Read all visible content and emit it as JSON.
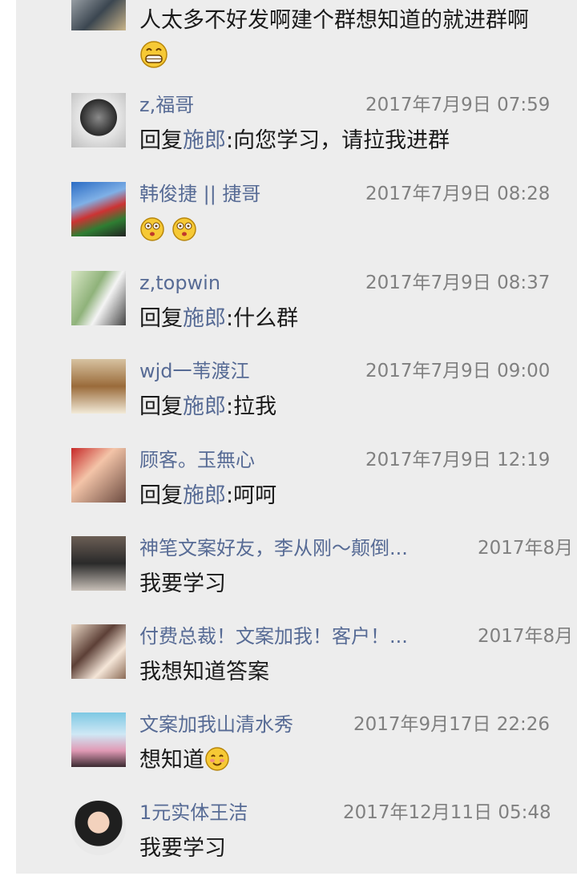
{
  "first_comment": {
    "line1": "人太多不好发啊建个群想知道的就进群啊",
    "emoji": "grin-emoji"
  },
  "comments": [
    {
      "name": "z,福哥",
      "time": "2017年7月9日 07:59",
      "prefix": "回复",
      "mention": "施郎",
      "body": ":向您学习，请拉我进群"
    },
    {
      "name": "韩俊捷 || 捷哥",
      "time": "2017年7月9日 08:28",
      "emoji": "dizzy-face-emoji x2"
    },
    {
      "name": "z,topwin",
      "time": "2017年7月9日 08:37",
      "prefix": "回复",
      "mention": "施郎",
      "body": ":什么群"
    },
    {
      "name": "wjd一苇渡江",
      "time": "2017年7月9日 09:00",
      "prefix": "回复",
      "mention": "施郎",
      "body": ":拉我"
    },
    {
      "name": "顾客。玉無心",
      "time": "2017年7月9日 12:19",
      "prefix": "回复",
      "mention": "施郎",
      "body": ":呵呵"
    },
    {
      "name": "神笔文案好友，李从刚～颠倒...",
      "time": "2017年8月",
      "body": "我要学习"
    },
    {
      "name": "付费总裁！文案加我！客户！...",
      "time": "2017年8月",
      "body": "我想知道答案"
    },
    {
      "name": "文案加我山清水秀",
      "time": "2017年9月17日 22:26",
      "body": "想知道",
      "emoji": "smile-emoji"
    },
    {
      "name": "1元实体王洁",
      "time": "2017年12月11日 05:48",
      "body": "我要学习"
    }
  ]
}
